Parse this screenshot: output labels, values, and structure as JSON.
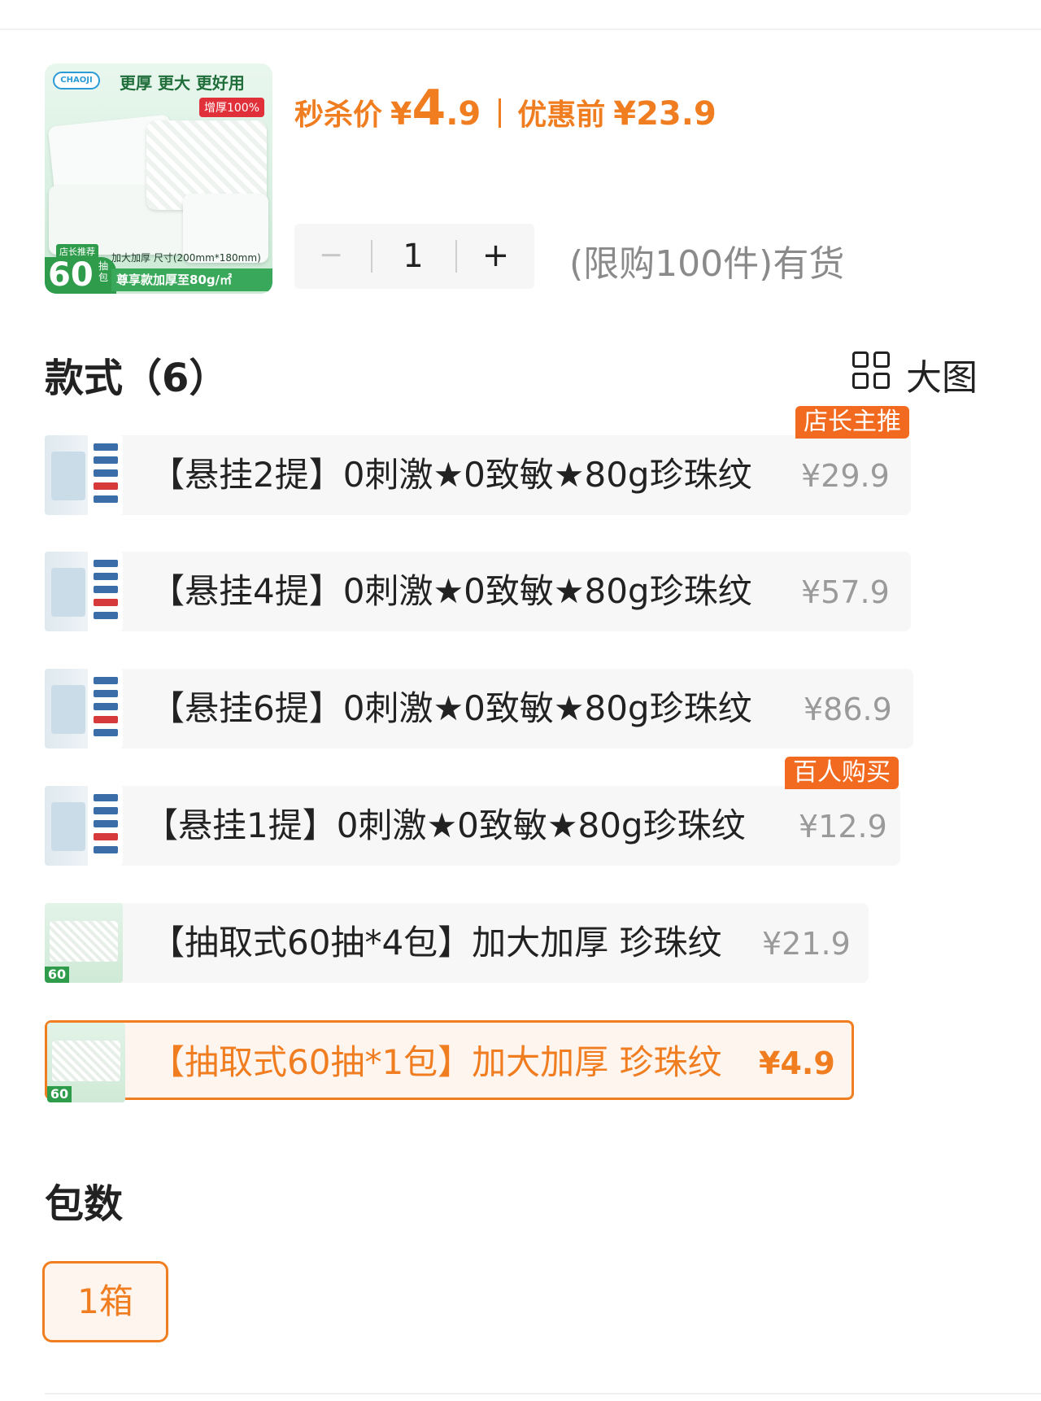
{
  "product": {
    "thumb": {
      "brand": "CHAOJI",
      "slogan": "更厚 更大 更好用",
      "thicker_badge": "增厚100%",
      "recommend_tag": "店长推荐",
      "count": "60",
      "count_unit": "抽包",
      "size_text": "加大加厚 尺寸(200mm*180mm)",
      "enjoy_text": "尊享款加厚至80g/㎡"
    },
    "flash_label": "秒杀价",
    "currency": "¥",
    "flash_price_int": "4",
    "flash_price_dec": ".9",
    "original_label": "优惠前",
    "original_price": "¥23.9"
  },
  "stepper": {
    "minus": "−",
    "quantity": "1",
    "plus": "+"
  },
  "limit_text": "(限购100件)有货",
  "styles_section": {
    "title": "款式（6）",
    "view_toggle_label": "大图",
    "view_toggle_icon": "grid-icon",
    "items": [
      {
        "name": "【悬挂2提】0刺激★0致敏★80g珍珠纹",
        "price": "¥29.9",
        "tag": "店长主推",
        "selected": false
      },
      {
        "name": "【悬挂4提】0刺激★0致敏★80g珍珠纹",
        "price": "¥57.9",
        "tag": "",
        "selected": false
      },
      {
        "name": "【悬挂6提】0刺激★0致敏★80g珍珠纹",
        "price": "¥86.9",
        "tag": "",
        "selected": false
      },
      {
        "name": "【悬挂1提】0刺激★0致敏★80g珍珠纹",
        "price": "¥12.9",
        "tag": "百人购买",
        "selected": false
      },
      {
        "name": "【抽取式60抽*4包】加大加厚 珍珠纹",
        "price": "¥21.9",
        "tag": "",
        "selected": false
      },
      {
        "name": "【抽取式60抽*1包】加大加厚 珍珠纹",
        "price": "¥4.9",
        "tag": "",
        "selected": true
      }
    ]
  },
  "pack_section": {
    "title": "包数",
    "options": [
      "1箱"
    ],
    "selected": "1箱"
  },
  "colors": {
    "accent": "#f07d20",
    "tag_bg": "#f26a1f",
    "muted_text": "#8a8a8a"
  }
}
